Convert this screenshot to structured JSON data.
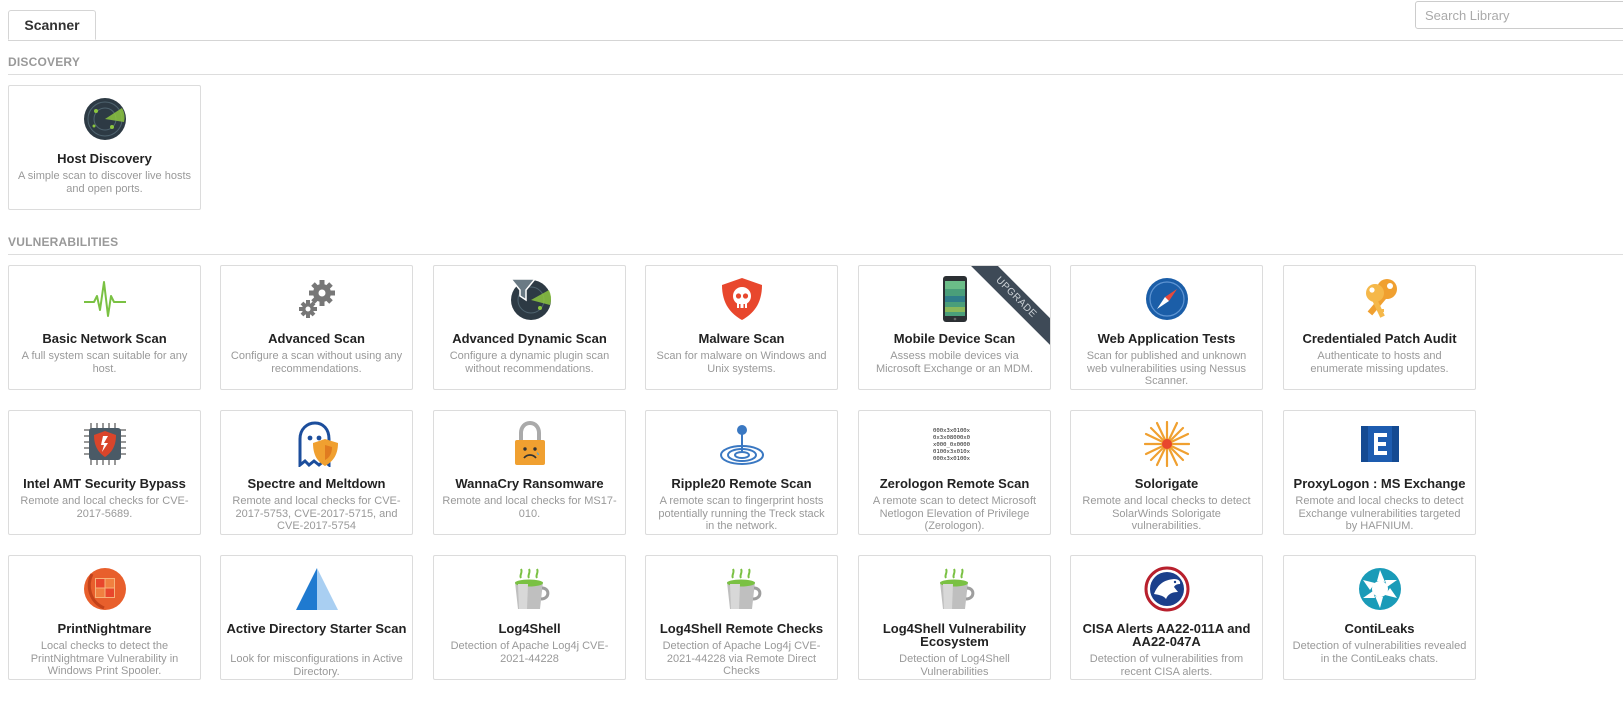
{
  "tabs": [
    {
      "label": "Scanner"
    }
  ],
  "search": {
    "placeholder": "Search Library"
  },
  "sections": {
    "discovery": {
      "title": "DISCOVERY"
    },
    "vulnerabilities": {
      "title": "VULNERABILITIES"
    }
  },
  "discovery_cards": [
    {
      "title": "Host Discovery",
      "desc": "A simple scan to discover live hosts and open ports.",
      "icon": "radar-icon"
    }
  ],
  "vuln_cards": [
    {
      "title": "Basic Network Scan",
      "desc": "A full system scan suitable for any host.",
      "icon": "pulse-icon"
    },
    {
      "title": "Advanced Scan",
      "desc": "Configure a scan without using any recommendations.",
      "icon": "gears-icon"
    },
    {
      "title": "Advanced Dynamic Scan",
      "desc": "Configure a dynamic plugin scan without recommendations.",
      "icon": "radar-filter-icon"
    },
    {
      "title": "Malware Scan",
      "desc": "Scan for malware on Windows and Unix systems.",
      "icon": "skull-shield-icon"
    },
    {
      "title": "Mobile Device Scan",
      "desc": "Assess mobile devices via Microsoft Exchange or an MDM.",
      "icon": "mobile-phone-icon",
      "badge": "UPGRADE"
    },
    {
      "title": "Web Application Tests",
      "desc": "Scan for published and unknown web vulnerabilities using Nessus Scanner.",
      "icon": "compass-icon"
    },
    {
      "title": "Credentialed Patch Audit",
      "desc": "Authenticate to hosts and enumerate missing updates.",
      "icon": "keys-icon"
    },
    {
      "title": "Intel AMT Security Bypass",
      "desc": "Remote and local checks for CVE-2017-5689.",
      "icon": "chip-shield-icon"
    },
    {
      "title": "Spectre and Meltdown",
      "desc": "Remote and local checks for CVE-2017-5753, CVE-2017-5715, and CVE-2017-5754",
      "icon": "ghost-shield-icon"
    },
    {
      "title": "WannaCry Ransomware",
      "desc": "Remote and local checks for MS17-010.",
      "icon": "padlock-icon"
    },
    {
      "title": "Ripple20 Remote Scan",
      "desc": "A remote scan to fingerprint hosts potentially running the Treck stack in the network.",
      "icon": "ripple-icon"
    },
    {
      "title": "Zerologon Remote Scan",
      "desc": "A remote scan to detect Microsoft Netlogon Elevation of Privilege (Zerologon).",
      "icon": "binary-text-icon"
    },
    {
      "title": "Solorigate",
      "desc": "Remote and local checks to detect SolarWinds Solorigate vulnerabilities.",
      "icon": "sunburst-icon"
    },
    {
      "title": "ProxyLogon : MS Exchange",
      "desc": "Remote and local checks to detect Exchange vulnerabilities targeted by HAFNIUM.",
      "icon": "exchange-icon"
    },
    {
      "title": "PrintNightmare",
      "desc": "Local checks to detect the PrintNightmare Vulnerability in Windows Print Spooler.",
      "icon": "printnightmare-icon"
    },
    {
      "title": "Active Directory Starter Scan",
      "desc": "Look for misconfigurations in Active Directory.",
      "icon": "pyramid-icon"
    },
    {
      "title": "Log4Shell",
      "desc": "Detection of Apache Log4j CVE-2021-44228",
      "icon": "coffee-cup-icon"
    },
    {
      "title": "Log4Shell Remote Checks",
      "desc": "Detection of Apache Log4j CVE-2021-44228 via Remote Direct Checks",
      "icon": "coffee-cup-icon"
    },
    {
      "title": "Log4Shell Vulnerability Ecosystem",
      "desc": "Detection of Log4Shell Vulnerabilities",
      "icon": "coffee-cup-icon"
    },
    {
      "title": "CISA Alerts AA22-011A and AA22-047A",
      "desc": "Detection of vulnerabilities from recent CISA alerts.",
      "icon": "eagle-seal-icon"
    },
    {
      "title": "ContiLeaks",
      "desc": "Detection of vulnerabilities revealed in the ContiLeaks chats.",
      "icon": "aperture-icon"
    }
  ]
}
